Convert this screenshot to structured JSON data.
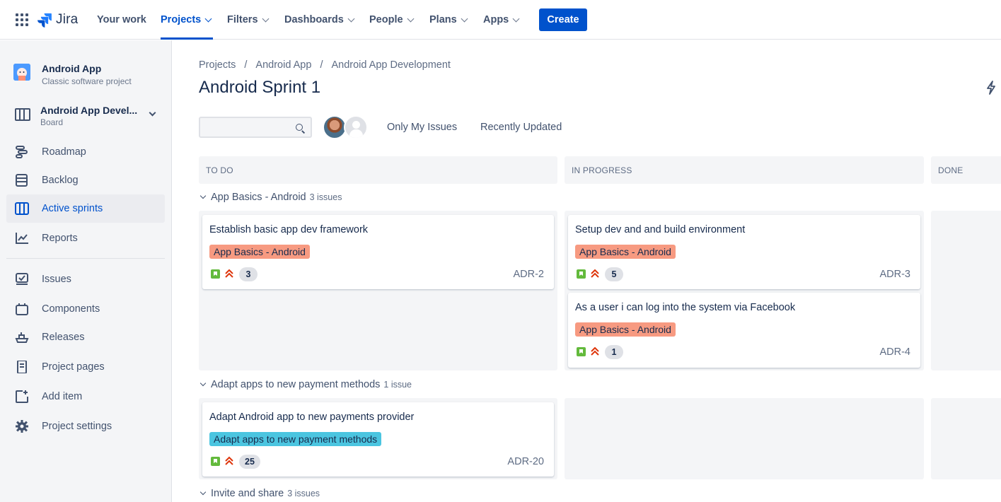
{
  "nav": {
    "logo": "Jira",
    "items": [
      {
        "label": "Your work"
      },
      {
        "label": "Projects"
      },
      {
        "label": "Filters"
      },
      {
        "label": "Dashboards"
      },
      {
        "label": "People"
      },
      {
        "label": "Plans"
      },
      {
        "label": "Apps"
      }
    ],
    "create": "Create",
    "accent_color": "#0052CC"
  },
  "sidebar": {
    "project_name": "Android App",
    "project_type": "Classic software project",
    "board_name": "Android App Devel...",
    "board_type": "Board",
    "items": [
      {
        "label": "Roadmap",
        "icon": "roadmap-icon"
      },
      {
        "label": "Backlog",
        "icon": "backlog-icon"
      },
      {
        "label": "Active sprints",
        "icon": "board-icon",
        "active": true
      },
      {
        "label": "Reports",
        "icon": "reports-icon"
      },
      {
        "label": "Issues",
        "icon": "issues-icon"
      },
      {
        "label": "Components",
        "icon": "components-icon"
      },
      {
        "label": "Releases",
        "icon": "releases-icon"
      },
      {
        "label": "Project pages",
        "icon": "pages-icon"
      },
      {
        "label": "Add item",
        "icon": "add-item-icon"
      },
      {
        "label": "Project settings",
        "icon": "gear-icon"
      }
    ]
  },
  "breadcrumb": [
    "Projects",
    "Android App",
    "Android App Development"
  ],
  "title": "Android Sprint 1",
  "filters": {
    "search_placeholder": "",
    "only_my_issues": "Only My Issues",
    "recently_updated": "Recently Updated"
  },
  "columns": [
    "TO DO",
    "IN PROGRESS",
    "DONE"
  ],
  "swimlanes": [
    {
      "name": "App Basics - Android",
      "count": "3 issues",
      "cards": [
        {
          "summary": "Establish basic app dev framework",
          "epic": "App Basics - Android",
          "epic_color": "#F79A81",
          "points": "3",
          "key": "ADR-2"
        },
        {
          "summary": "Setup dev and and build environment",
          "epic": "App Basics - Android",
          "epic_color": "#F79A81",
          "points": "5",
          "key": "ADR-3"
        },
        {
          "summary": "As a user i can log into the system via Facebook",
          "epic": "App Basics - Android",
          "epic_color": "#F79A81",
          "points": "1",
          "key": "ADR-4"
        }
      ]
    },
    {
      "name": "Adapt apps to new payment methods",
      "count": "1 issue",
      "cards": [
        {
          "summary": "Adapt Android app to new payments provider",
          "epic": "Adapt apps to new payment methods",
          "epic_color": "#4BC5E0",
          "points": "25",
          "key": "ADR-20"
        }
      ]
    },
    {
      "name": "Invite and share",
      "count": "3 issues"
    }
  ]
}
